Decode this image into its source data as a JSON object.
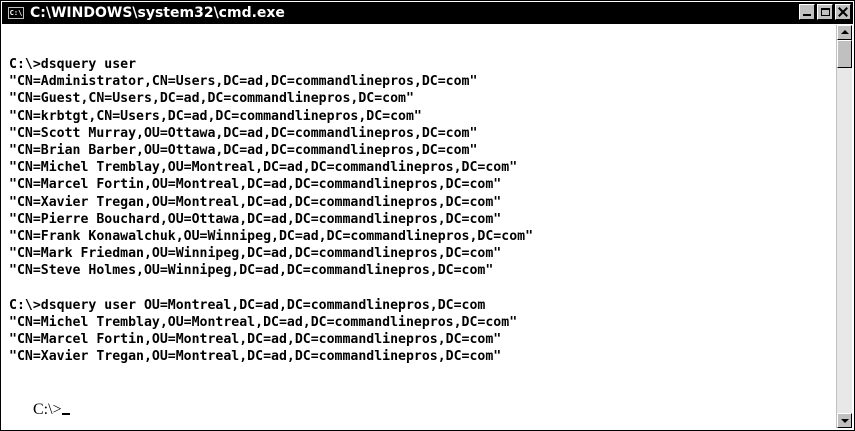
{
  "window": {
    "icon_text": "C:\\",
    "title": "C:\\WINDOWS\\system32\\cmd.exe"
  },
  "caption_buttons": {
    "minimize": "minimize-icon",
    "maximize": "maximize-icon",
    "close": "close-icon"
  },
  "console": {
    "lines": [
      "C:\\>dsquery user",
      "\"CN=Administrator,CN=Users,DC=ad,DC=commandlinepros,DC=com\"",
      "\"CN=Guest,CN=Users,DC=ad,DC=commandlinepros,DC=com\"",
      "\"CN=krbtgt,CN=Users,DC=ad,DC=commandlinepros,DC=com\"",
      "\"CN=Scott Murray,OU=Ottawa,DC=ad,DC=commandlinepros,DC=com\"",
      "\"CN=Brian Barber,OU=Ottawa,DC=ad,DC=commandlinepros,DC=com\"",
      "\"CN=Michel Tremblay,OU=Montreal,DC=ad,DC=commandlinepros,DC=com\"",
      "\"CN=Marcel Fortin,OU=Montreal,DC=ad,DC=commandlinepros,DC=com\"",
      "\"CN=Xavier Tregan,OU=Montreal,DC=ad,DC=commandlinepros,DC=com\"",
      "\"CN=Pierre Bouchard,OU=Ottawa,DC=ad,DC=commandlinepros,DC=com\"",
      "\"CN=Frank Konawalchuk,OU=Winnipeg,DC=ad,DC=commandlinepros,DC=com\"",
      "\"CN=Mark Friedman,OU=Winnipeg,DC=ad,DC=commandlinepros,DC=com\"",
      "\"CN=Steve Holmes,OU=Winnipeg,DC=ad,DC=commandlinepros,DC=com\"",
      "",
      "C:\\>dsquery user OU=Montreal,DC=ad,DC=commandlinepros,DC=com",
      "\"CN=Michel Tremblay,OU=Montreal,DC=ad,DC=commandlinepros,DC=com\"",
      "\"CN=Marcel Fortin,OU=Montreal,DC=ad,DC=commandlinepros,DC=com\"",
      "\"CN=Xavier Tregan,OU=Montreal,DC=ad,DC=commandlinepros,DC=com\"",
      ""
    ],
    "prompt": "C:\\>"
  },
  "colors": {
    "titlebar_bg": "#000000",
    "titlebar_text": "#ffffff",
    "console_bg": "#ffffff",
    "console_text": "#000000"
  }
}
